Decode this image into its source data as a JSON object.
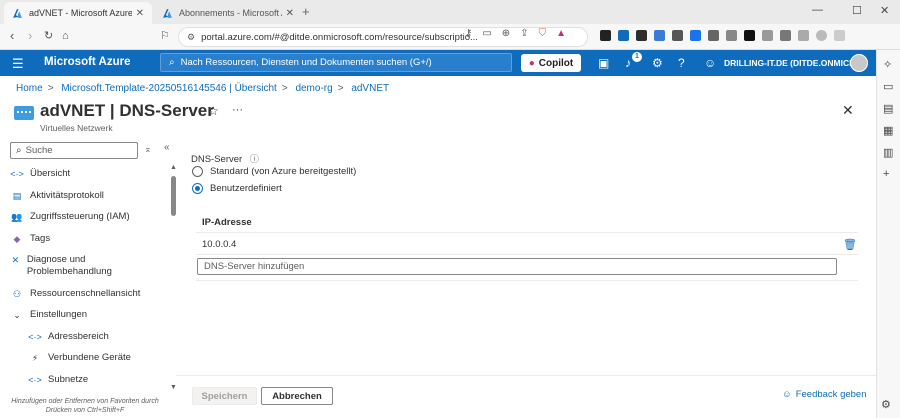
{
  "browser": {
    "tabs": [
      {
        "title": "adVNET - Microsoft Azure",
        "active": true
      },
      {
        "title": "Abonnements - Microsoft Azure",
        "active": false
      }
    ],
    "url": "portal.azure.com/#@ditde.onmicrosoft.com/resource/subscriptio..."
  },
  "azure": {
    "brand": "Microsoft Azure",
    "search_placeholder": "Nach Ressourcen, Diensten und Dokumenten suchen (G+/)",
    "copilot_label": "Copilot",
    "notification_count": "1",
    "account": "DRILLING-IT.DE (DITDE.ONMICR...",
    "accent": "#0f6cbd"
  },
  "breadcrumb": [
    "Home",
    "Microsoft.Template-20250516145546 | Übersicht",
    "demo-rg",
    "adVNET"
  ],
  "page": {
    "title": "adVNET | DNS-Server",
    "subtitle": "Virtuelles Netzwerk"
  },
  "menu": {
    "search_placeholder": "Suche",
    "items": [
      {
        "label": "Übersicht",
        "icon": "code-icon"
      },
      {
        "label": "Aktivitätsprotokoll",
        "icon": "log-icon"
      },
      {
        "label": "Zugriffssteuerung (IAM)",
        "icon": "people-icon"
      },
      {
        "label": "Tags",
        "icon": "tag-icon"
      },
      {
        "label": "Diagnose und Problembehandlung",
        "icon": "wrench-icon"
      },
      {
        "label": "Ressourcenschnellansicht",
        "icon": "hierarchy-icon"
      },
      {
        "label": "Einstellungen",
        "icon": "chevron-down-icon"
      },
      {
        "label": "Adressbereich",
        "icon": "code-icon"
      },
      {
        "label": "Verbundene Geräte",
        "icon": "plug-icon"
      },
      {
        "label": "Subnetze",
        "icon": "code-icon"
      }
    ],
    "hint_line1": "Hinzufügen oder Entfernen von Favoriten durch",
    "hint_line2": "Drücken von Ctrl+Shift+F"
  },
  "content": {
    "dns_label": "DNS-Server",
    "options": [
      "Standard (von Azure bereitgestellt)",
      "Benutzerdefiniert"
    ],
    "selected_option": "Benutzerdefiniert",
    "column_header": "IP-Adresse",
    "ip_addresses": [
      "10.0.0.4"
    ],
    "add_placeholder": "DNS-Server hinzufügen"
  },
  "footer": {
    "save_label": "Speichern",
    "cancel_label": "Abbrechen",
    "feedback_label": "Feedback geben"
  }
}
